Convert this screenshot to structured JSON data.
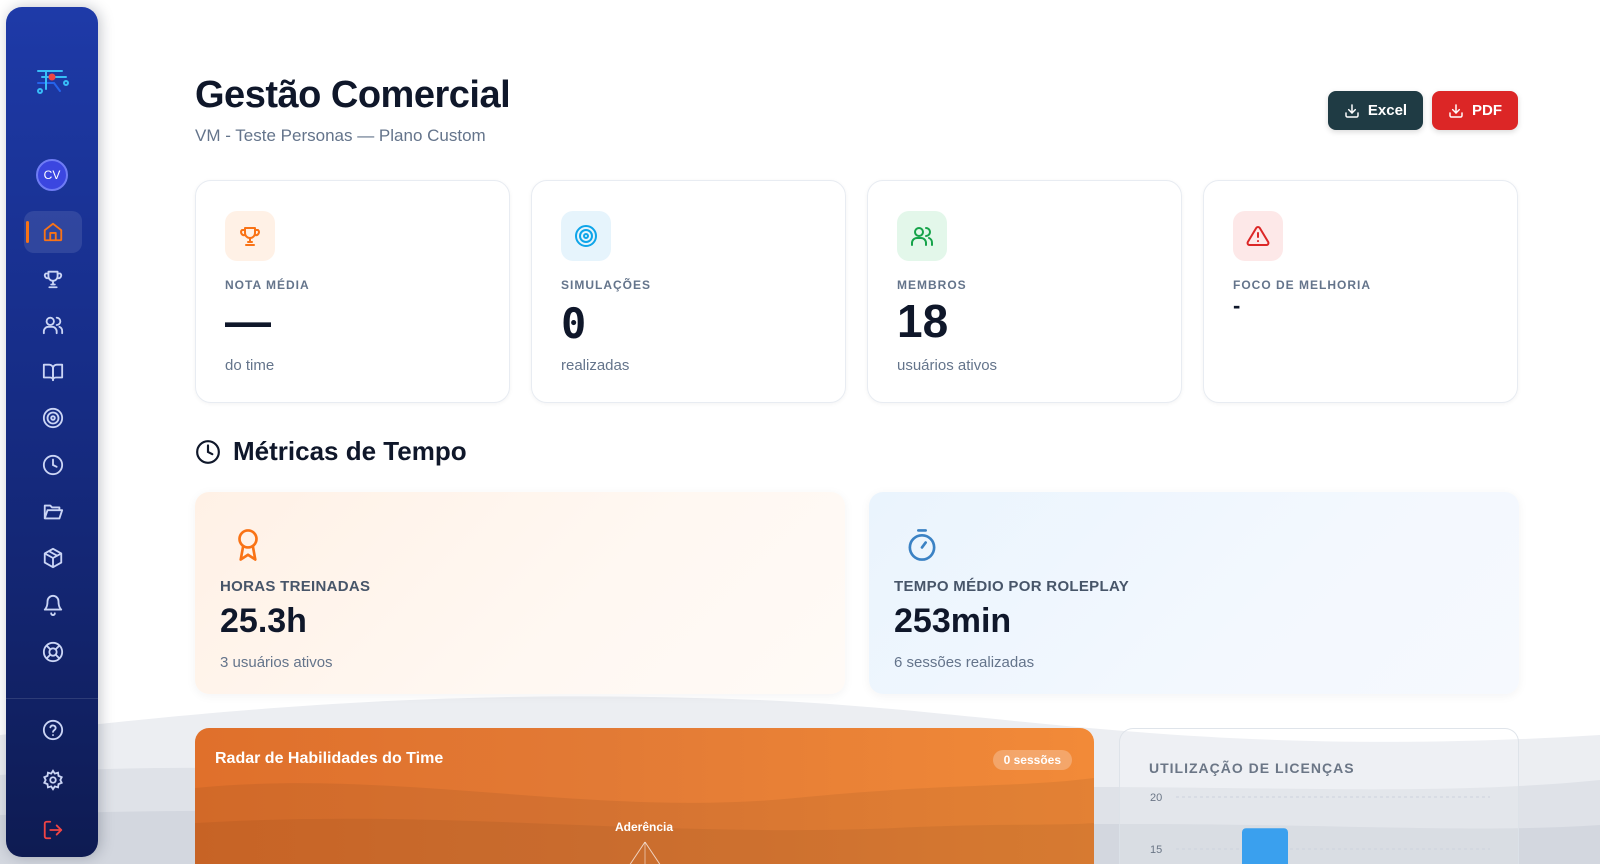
{
  "app": {
    "user_initials": "CV"
  },
  "sidebar": {
    "items": [
      {
        "name": "home",
        "icon": "home-icon",
        "active": true
      },
      {
        "name": "ranking",
        "icon": "trophy-icon"
      },
      {
        "name": "users",
        "icon": "users-icon"
      },
      {
        "name": "library",
        "icon": "book-icon"
      },
      {
        "name": "simulations",
        "icon": "target-icon"
      },
      {
        "name": "history",
        "icon": "clock-icon"
      },
      {
        "name": "files",
        "icon": "folder-icon"
      },
      {
        "name": "modules",
        "icon": "package-icon"
      },
      {
        "name": "notifications",
        "icon": "bell-icon"
      },
      {
        "name": "support",
        "icon": "lifebuoy-icon"
      }
    ],
    "bottom_items": [
      {
        "name": "help",
        "icon": "help-circle-icon"
      },
      {
        "name": "settings",
        "icon": "gear-icon"
      },
      {
        "name": "logout",
        "icon": "logout-icon"
      }
    ]
  },
  "header": {
    "title": "Gestão Comercial",
    "subtitle": "VM - Teste Personas — Plano Custom",
    "excel_label": "Excel",
    "pdf_label": "PDF"
  },
  "stats": [
    {
      "label": "NOTA MÉDIA",
      "value": "—",
      "sub": "do time",
      "icon": "trophy-icon",
      "color": "#f97316",
      "bg": "#fff1e6"
    },
    {
      "label": "SIMULAÇÕES",
      "value": "0",
      "sub": "realizadas",
      "icon": "target-icon",
      "color": "#0ea5e9",
      "bg": "#e6f4fc"
    },
    {
      "label": "MEMBROS",
      "value": "18",
      "sub": "usuários ativos",
      "icon": "users-icon",
      "color": "#16a34a",
      "bg": "#e3f7ea"
    },
    {
      "label": "FOCO DE MELHORIA",
      "value": "-",
      "sub": "",
      "icon": "alert-triangle-icon",
      "color": "#dc2626",
      "bg": "#fde8e8"
    }
  ],
  "time_section": {
    "title": "Métricas de Tempo",
    "cards": [
      {
        "label": "HORAS TREINADAS",
        "value": "25.3h",
        "sub": "3 usuários ativos",
        "icon": "award-icon",
        "color": "#f97316"
      },
      {
        "label": "TEMPO MÉDIO POR ROLEPLAY",
        "value": "253min",
        "sub": "6 sessões realizadas",
        "icon": "timer-icon",
        "color": "#3b82c4"
      }
    ]
  },
  "radar": {
    "title": "Radar de Habilidades do Time",
    "badge": "0 sessões",
    "axis_top": "Aderência"
  },
  "licenses": {
    "title": "UTILIZAÇÃO DE LICENÇAS",
    "y_ticks": [
      "20",
      "15"
    ],
    "bar_value": 17,
    "bar_color": "#3aa0ee"
  },
  "colors": {
    "accent": "#f97316",
    "sidebar": "#1a2f8a",
    "excel": "#1f3b44",
    "pdf": "#dc2626"
  }
}
